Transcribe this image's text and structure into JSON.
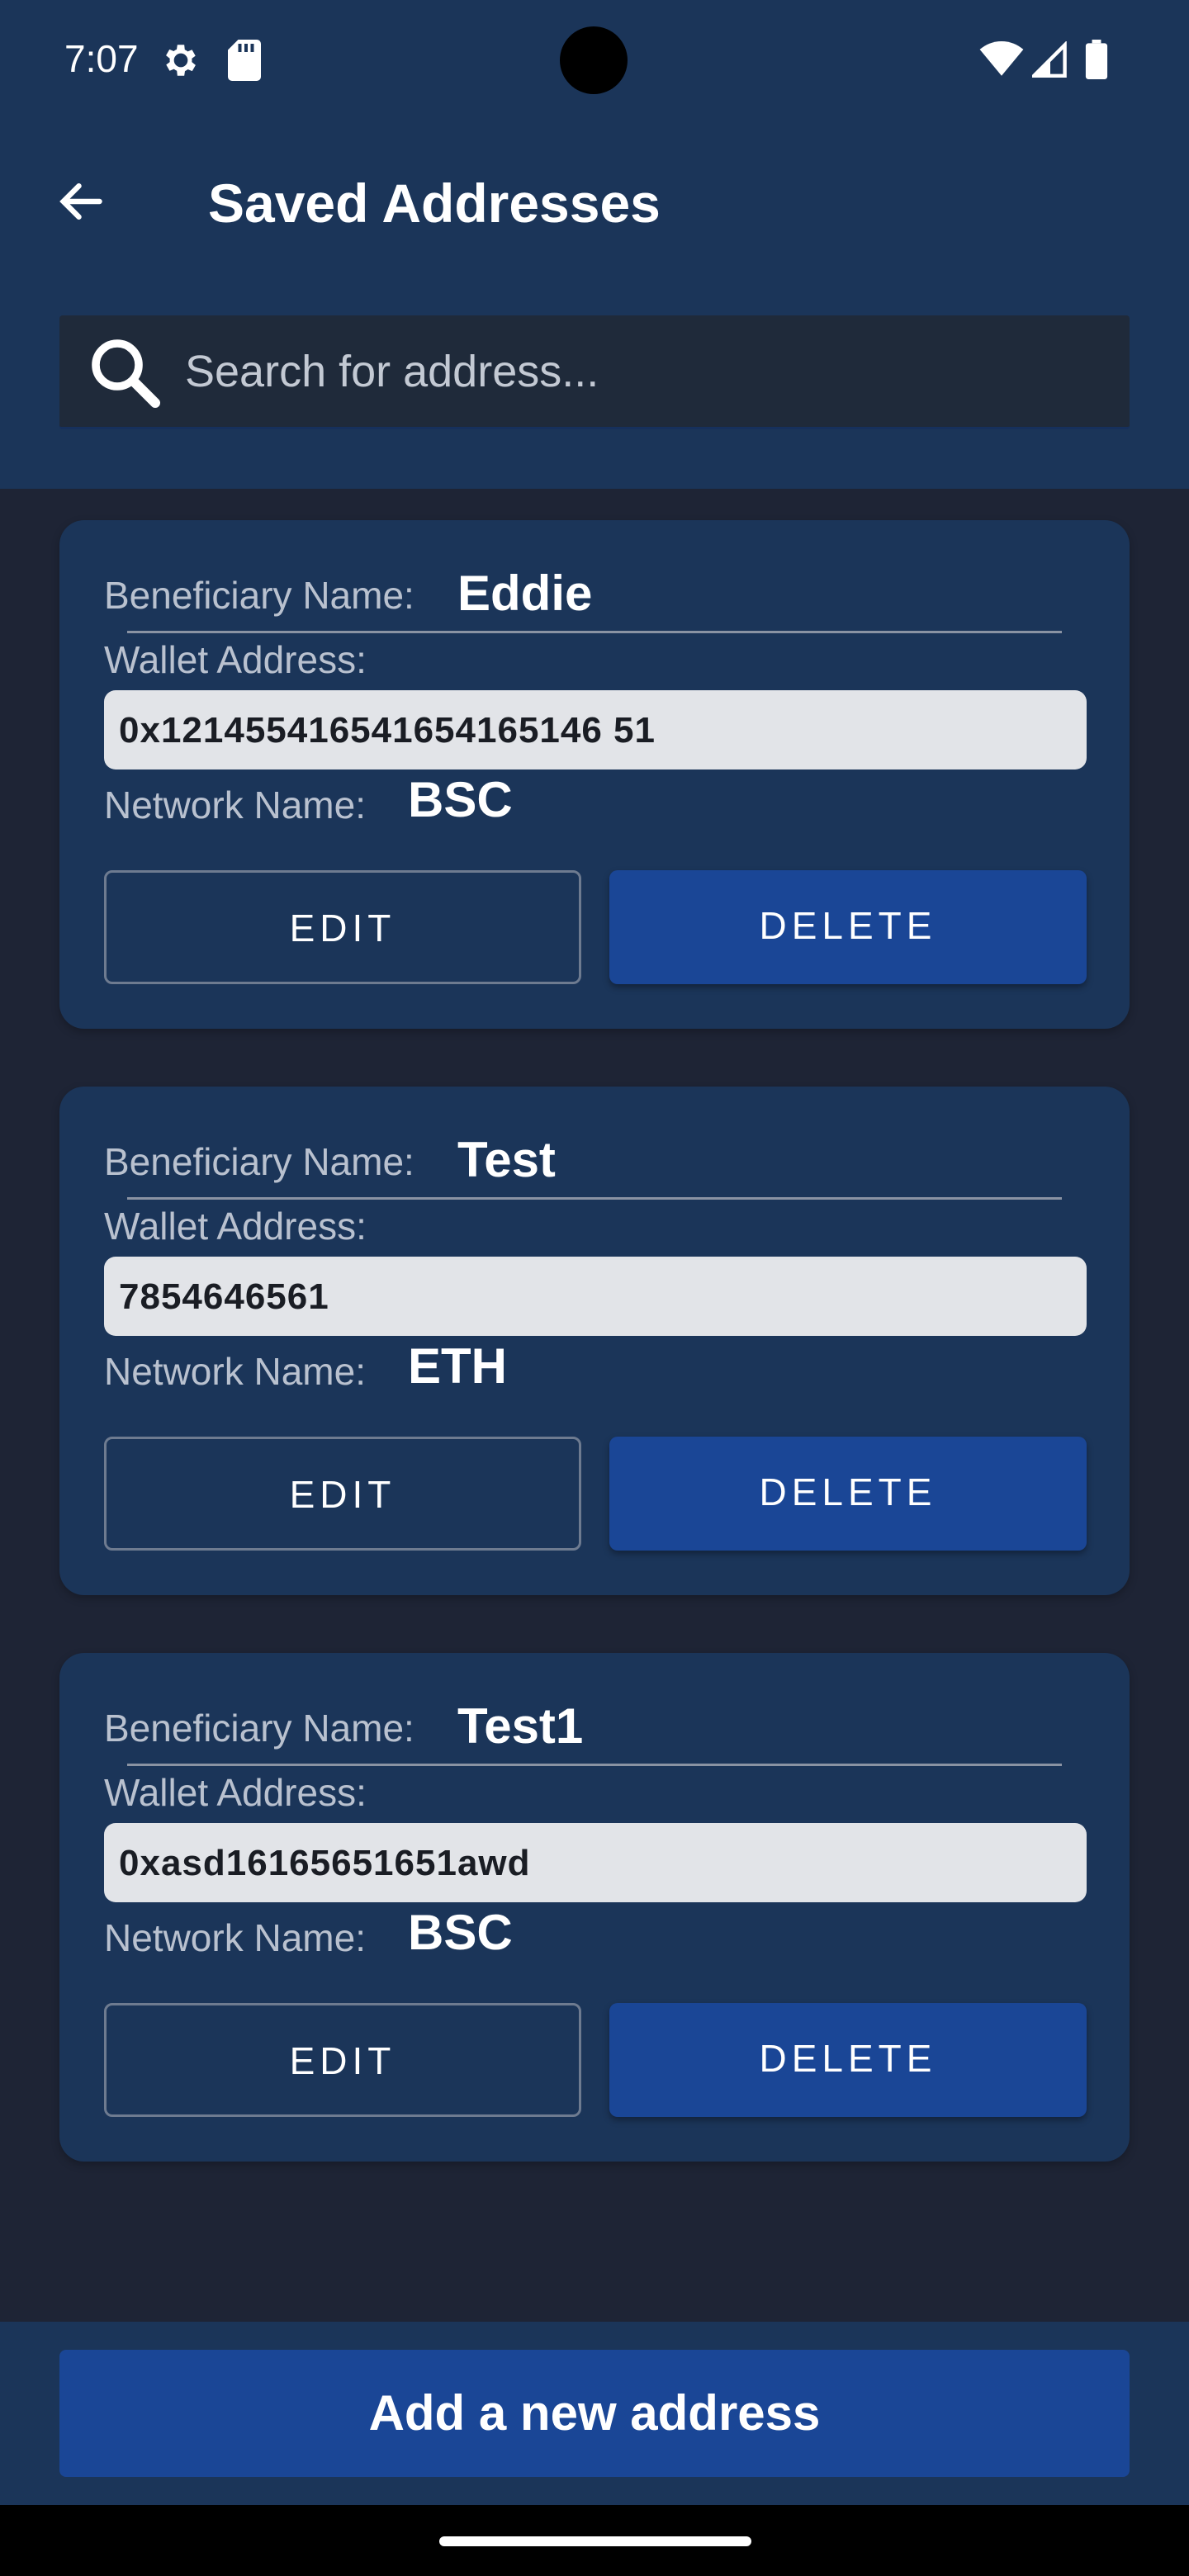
{
  "status_bar": {
    "time": "7:07",
    "icons": [
      "gear-icon",
      "sd-card-icon",
      "wifi-icon",
      "signal-icon",
      "battery-icon"
    ]
  },
  "header": {
    "title": "Saved Addresses",
    "back_icon": "arrow-left-icon"
  },
  "search": {
    "placeholder": "Search for address...",
    "value": "",
    "icon": "search-icon"
  },
  "labels": {
    "beneficiary": "Beneficiary Name:",
    "wallet": "Wallet Address:",
    "network": "Network Name:",
    "edit": "EDIT",
    "delete": "DELETE"
  },
  "addresses": [
    {
      "beneficiary": "Eddie",
      "wallet": "0x121455416541654165146 51",
      "network": "BSC"
    },
    {
      "beneficiary": "Test",
      "wallet": "7854646561",
      "network": "ETH"
    },
    {
      "beneficiary": "Test1",
      "wallet": "0xasd16165651651awd",
      "network": "BSC"
    }
  ],
  "footer": {
    "add_button": "Add a new address"
  },
  "colors": {
    "header_bg": "#1b3559",
    "page_bg": "#1e2435",
    "primary_button": "#1a4696",
    "wallet_field_bg": "#e2e4e8"
  }
}
